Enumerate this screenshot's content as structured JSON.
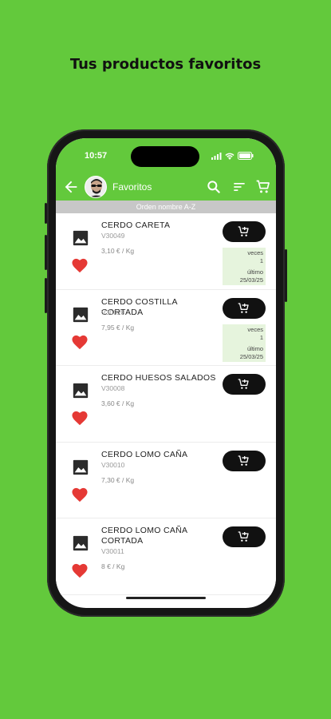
{
  "headline": "Tus productos favoritos",
  "status": {
    "time": "10:57"
  },
  "toolbar": {
    "title": "Favoritos"
  },
  "sort_label": "Orden nombre A-Z",
  "products": [
    {
      "name": "CERDO CARETA",
      "code": "V30049",
      "price": "3,10 € / Kg",
      "veces_label": "veces",
      "veces": "1",
      "ultimo_label": "último",
      "ultimo": "25/03/25"
    },
    {
      "name": "CERDO COSTILLA CORTADA",
      "code": "V30028",
      "price": "7,95 € / Kg",
      "veces_label": "veces",
      "veces": "1",
      "ultimo_label": "último",
      "ultimo": "25/03/25"
    },
    {
      "name": "CERDO HUESOS SALADOS",
      "code": "V30008",
      "price": "3,60 € / Kg"
    },
    {
      "name": "CERDO LOMO CAÑA",
      "code": "V30010",
      "price": "7,30 € / Kg"
    },
    {
      "name": "CERDO LOMO CAÑA CORTADA",
      "code": "V30011",
      "price": "8 € / Kg"
    }
  ],
  "colors": {
    "brand": "#63c93c",
    "heart": "#e53935",
    "stats_bg": "#e6f4dd"
  },
  "icons": [
    "back-arrow-icon",
    "search-icon",
    "sort-icon",
    "cart-icon",
    "image-icon",
    "heart-icon",
    "add-to-cart-icon"
  ]
}
